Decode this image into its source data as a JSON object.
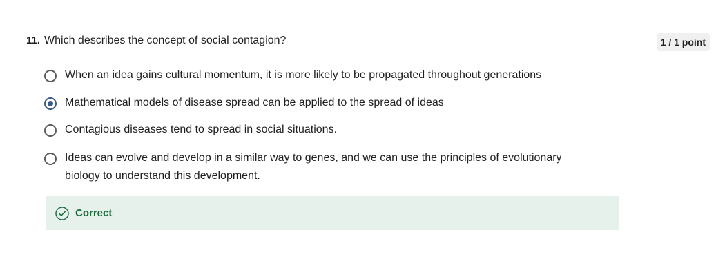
{
  "question": {
    "number": "11.",
    "text": "Which describes the concept of social contagion?",
    "score": "1 / 1 point"
  },
  "options": [
    {
      "text": "When an idea gains cultural momentum, it is more likely to be propagated throughout generations",
      "selected": false
    },
    {
      "text": "Mathematical models of disease spread can be applied to the spread of ideas",
      "selected": true
    },
    {
      "text": "Contagious diseases tend to spread in social situations.",
      "selected": false
    },
    {
      "text": "Ideas can evolve and develop in a similar way to genes, and we can use the principles of evolutionary biology to understand this development.",
      "selected": false
    }
  ],
  "feedback": {
    "label": "Correct",
    "icon": "check-circle-icon",
    "color": "#1e6b3d",
    "background": "#e6f1ec"
  },
  "colors": {
    "radio_selected": "#3a5a8c"
  }
}
